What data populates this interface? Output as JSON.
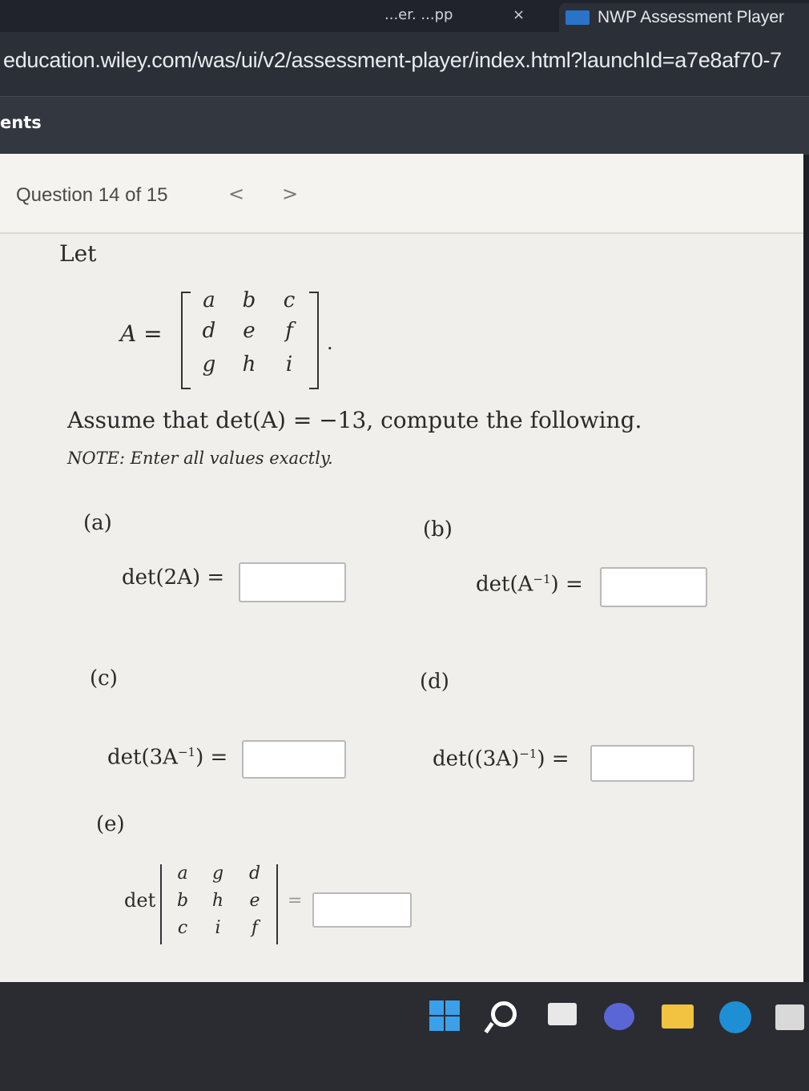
{
  "browser": {
    "tab_fragment": "...er. ...pp",
    "tab_close": "×",
    "active_tab_title": "NWP Assessment Player",
    "url": "education.wiley.com/was/ui/v2/assessment-player/index.html?launchId=a7e8af70-7",
    "bookmark_fragment": "ents"
  },
  "question": {
    "counter": "Question 14 of 15",
    "prev": "<",
    "next": ">",
    "let": "Let",
    "matrix_name": "A =",
    "matrix_rows": [
      [
        "a",
        "b",
        "c"
      ],
      [
        "d",
        "e",
        "f"
      ],
      [
        "g",
        "h",
        "i"
      ]
    ],
    "assume": "Assume that det(A) = −13, compute the following.",
    "note": "NOTE: Enter all values exactly."
  },
  "parts": {
    "a": {
      "label": "(a)",
      "expr": "det(2A) =",
      "value": ""
    },
    "b": {
      "label": "(b)",
      "expr_pre": "det(A",
      "sup": "−1",
      "expr_post": ") =",
      "value": ""
    },
    "c": {
      "label": "(c)",
      "expr_pre": "det(3A",
      "sup": "−1",
      "expr_post": ") =",
      "value": ""
    },
    "d": {
      "label": "(d)",
      "expr_pre": "det((3A)",
      "sup": "−1",
      "expr_post": ") =",
      "value": ""
    },
    "e": {
      "label": "(e)",
      "det": "det",
      "equals": "=",
      "rows": [
        [
          "a",
          "g",
          "d"
        ],
        [
          "b",
          "h",
          "e"
        ],
        [
          "c",
          "i",
          "f"
        ]
      ],
      "value": ""
    }
  },
  "colors": {
    "page_bg": "#f1f0ec",
    "taskbar_bg": "#2a2c31",
    "accent": "#3aa0ea"
  }
}
